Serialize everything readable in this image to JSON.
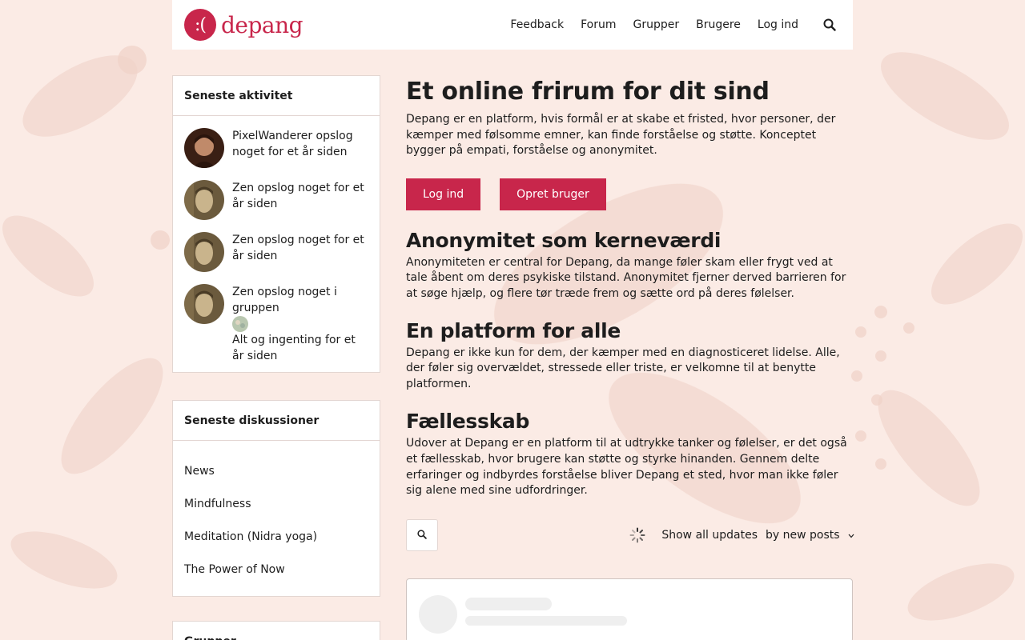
{
  "header": {
    "logo_mark": ":(",
    "logo_text": "depang",
    "nav": [
      "Feedback",
      "Forum",
      "Grupper",
      "Brugere",
      "Log ind"
    ]
  },
  "activity": {
    "title": "Seneste aktivitet",
    "items": [
      {
        "text": "PixelWanderer opslog noget for et år siden",
        "avatar": "person-avatar"
      },
      {
        "text": "Zen opslog noget for et år siden",
        "avatar": "buddha-avatar"
      },
      {
        "text": "Zen opslog noget for et år siden",
        "avatar": "buddha-avatar"
      },
      {
        "text": "Zen opslog noget i gruppen",
        "group": "Alt og ingenting for et år siden",
        "avatar": "buddha-avatar"
      }
    ]
  },
  "discussions": {
    "title": "Seneste diskussioner",
    "items": [
      "News",
      "Mindfulness",
      "Meditation (Nidra yoga)",
      "The Power of Now"
    ]
  },
  "groups": {
    "title": "Grupper"
  },
  "main": {
    "title": "Et online frirum for dit sind",
    "intro": "Depang er en platform, hvis formål er at skabe et fristed, hvor personer, der kæmper med følsomme emner, kan finde forståelse og støtte. Konceptet bygger på empati, forståelse og anonymitet.",
    "login_button": "Log ind",
    "signup_button": "Opret bruger",
    "sections": [
      {
        "heading": "Anonymitet som kerneværdi",
        "text": "Anonymiteten er central for Depang, da mange føler skam eller frygt ved at tale åbent om deres psykiske tilstand. Anonymitet fjerner derved barrieren for at søge hjælp, og flere tør træde frem og sætte ord på deres følelser."
      },
      {
        "heading": "En platform for alle",
        "text": "Depang er ikke kun for dem, der kæmper med en diagnosticeret lidelse. Alle, der føler sig overvældet, stressede eller triste, er velkomne til at benytte platformen."
      },
      {
        "heading": "Fællesskab",
        "text": "Udover at Depang er en platform til at udtrykke tanker og følelser, er det også et fællesskab, hvor brugere kan støtte og styrke hinanden. Gennem delte erfaringer og indbyrdes forståelse bliver Depang et sted, hvor man ikke føler sig alene med sine udfordringer."
      }
    ],
    "filter_label": "Show all updates",
    "sort_label": "by new posts"
  },
  "colors": {
    "brand": "#c8264b",
    "background": "#fbebe5"
  }
}
